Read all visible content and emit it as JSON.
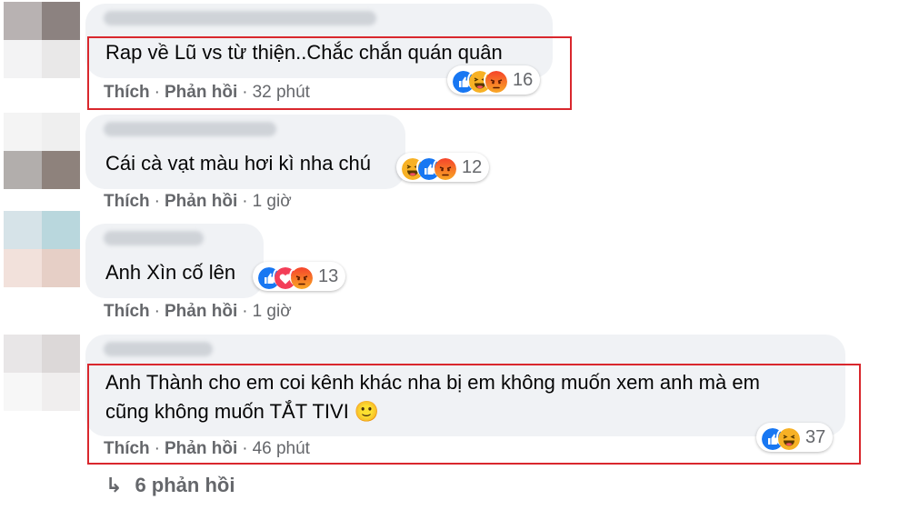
{
  "comments": [
    {
      "text": "Rap về Lũ vs từ thiện..Chắc chắn quán quân",
      "like": "Thích",
      "reply": "Phản hồi",
      "time": "32 phút",
      "reaction_icons": [
        "like-icon",
        "haha-icon",
        "angry-icon"
      ],
      "reaction_count": "16"
    },
    {
      "text": "Cái cà vạt màu hơi kì nha chú",
      "like": "Thích",
      "reply": "Phản hồi",
      "time": "1 giờ",
      "reaction_icons": [
        "haha-icon",
        "like-icon",
        "angry-icon"
      ],
      "reaction_count": "12"
    },
    {
      "text": "Anh Xìn cố lên",
      "like": "Thích",
      "reply": "Phản hồi",
      "time": "1 giờ",
      "reaction_icons": [
        "like-icon",
        "love-icon",
        "angry-icon"
      ],
      "reaction_count": "13"
    },
    {
      "text_line1": "Anh Thành cho em coi kênh khác nha bị em không muốn xem anh mà em",
      "text_line2": "cũng không muốn TẮT TIVI 🙂",
      "like": "Thích",
      "reply": "Phản hồi",
      "time": "46 phút",
      "reaction_icons": [
        "like-icon",
        "haha-icon"
      ],
      "reaction_count": "37"
    }
  ],
  "view_replies": "6 phản hồi",
  "colors": {
    "bubble": "#f0f2f5",
    "secondary_text": "#65676b",
    "highlight_box": "#d9272d",
    "like_blue": "#1877f2",
    "love_red": "#f33e58",
    "haha_yellow": "#f7b125",
    "angry_orange": "#e9710f"
  }
}
